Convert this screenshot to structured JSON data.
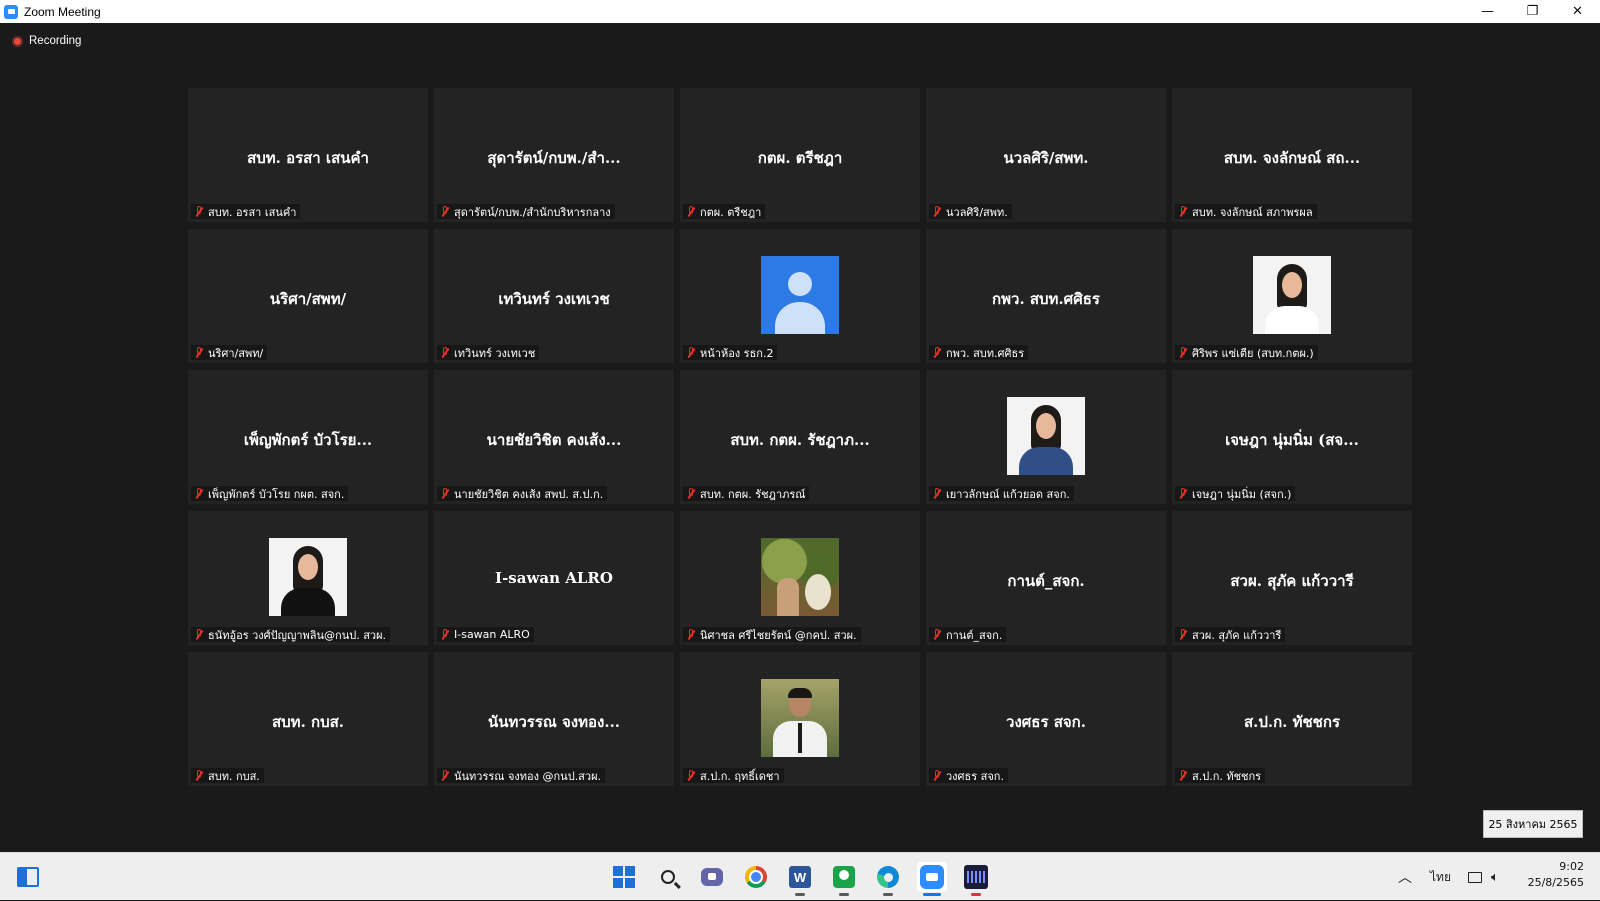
{
  "window": {
    "title": "Zoom Meeting",
    "controls": {
      "minimize": "—",
      "maximize": "❐",
      "close": "✕"
    }
  },
  "meeting": {
    "recording_label": "Recording",
    "participants": [
      {
        "display_name": "สบท. อรสา เสนคำ",
        "label": "สบท. อรสา เสนคำ",
        "avatar": "none",
        "muted": true
      },
      {
        "display_name": "สุดารัตน์/กบพ./สำ...",
        "label": "สุดารัตน์/กบพ./สำนักบริหารกลาง",
        "avatar": "none",
        "muted": true
      },
      {
        "display_name": "กตผ. ตรีชฎา",
        "label": "กตผ. ตรีชฎา",
        "avatar": "none",
        "muted": true
      },
      {
        "display_name": "นวลศิริ/สพท.",
        "label": "นวลศิริ/สพท.",
        "avatar": "none",
        "muted": true
      },
      {
        "display_name": "สบท. จงลักษณ์ สถ...",
        "label": "สบท. จงลักษณ์ สภาพรผล",
        "avatar": "none",
        "muted": true
      },
      {
        "display_name": "นริศา/สพท/",
        "label": "นริศา/สพท/",
        "avatar": "none",
        "muted": true
      },
      {
        "display_name": "เทวินทร์ วงเทเวช",
        "label": "เทวินทร์ วงเทเวช",
        "avatar": "none",
        "muted": true
      },
      {
        "display_name": "",
        "label": "หน้าห้อง รธก.2",
        "avatar": "default",
        "muted": true
      },
      {
        "display_name": "กพว. สบท.ศศิธร",
        "label": "กพว. สบท.ศศิธร",
        "avatar": "none",
        "muted": true
      },
      {
        "display_name": "",
        "label": "ศิริพร แซ่เตีย (สบท.กตผ.)",
        "avatar": "photo-woman-white",
        "muted": true
      },
      {
        "display_name": "เพ็ญพักตร์ บัวโรย...",
        "label": "เพ็ญพักตร์ บัวโรย กผต. สจก.",
        "avatar": "none",
        "muted": true
      },
      {
        "display_name": "นายชัยวิชิต คงเส้ง...",
        "label": "นายชัยวิชิต คงเส้ง สพป. ส.ป.ก.",
        "avatar": "none",
        "muted": true
      },
      {
        "display_name": "สบท. กตผ. รัชฎาภ...",
        "label": "สบท. กตผ. รัชฎาภรณ์",
        "avatar": "none",
        "muted": true
      },
      {
        "display_name": "",
        "label": "เยาวลักษณ์ แก้วยอด สจก.",
        "avatar": "photo-woman-blue",
        "muted": true
      },
      {
        "display_name": "เจษฎา นุ่มนิ่ม (สจ...",
        "label": "เจษฎา นุ่มนิ่ม (สจก.)",
        "avatar": "none",
        "muted": true
      },
      {
        "display_name": "",
        "label": "ธนัทอู้อร วงศ์ปัญญาพลิน@กนป. สวผ.",
        "avatar": "photo-woman-black",
        "muted": true
      },
      {
        "display_name": "I-sawan ALRO",
        "label": "I-sawan ALRO",
        "avatar": "none",
        "muted": true
      },
      {
        "display_name": "",
        "label": "นิศาชล ศรีไชยรัตน์ @กคป. สวผ.",
        "avatar": "photo-garden",
        "muted": true
      },
      {
        "display_name": "กานต์_สจก.",
        "label": "กานต์_สจก.",
        "avatar": "none",
        "muted": true
      },
      {
        "display_name": "สวผ. สุภัค แก้ววารี",
        "label": "สวผ. สุภัค แก้ววารี",
        "avatar": "none",
        "muted": true
      },
      {
        "display_name": "สบท. กบส.",
        "label": "สบท. กบส.",
        "avatar": "none",
        "muted": true
      },
      {
        "display_name": "นันทวรรณ จงทอง...",
        "label": "นันทวรรณ จงทอง @กนป.สวผ.",
        "avatar": "none",
        "muted": true
      },
      {
        "display_name": "",
        "label": "ส.ป.ก. ฤทธิ์เดชา",
        "avatar": "photo-man",
        "muted": true
      },
      {
        "display_name": "วงศธร สจก.",
        "label": "วงศธร สจก.",
        "avatar": "none",
        "muted": true
      },
      {
        "display_name": "ส.ป.ก. ทัชชกร",
        "label": "ส.ป.ก. ทัชชกร",
        "avatar": "none",
        "muted": true
      }
    ]
  },
  "date_tooltip": "25 สิงหาคม 2565",
  "taskbar": {
    "apps": [
      "widgets",
      "start",
      "search",
      "chat",
      "chrome",
      "word",
      "people",
      "edge",
      "zoom",
      "media-app"
    ],
    "tray": {
      "language": "ไทย"
    },
    "clock": {
      "time": "9:02",
      "date": "25/8/2565"
    }
  },
  "colors": {
    "accent": "#2d8cff",
    "recording": "#e8473d",
    "muted_mic": "#e0312a",
    "tile_bg": "#232323",
    "window_bg": "#1a1a1a"
  }
}
